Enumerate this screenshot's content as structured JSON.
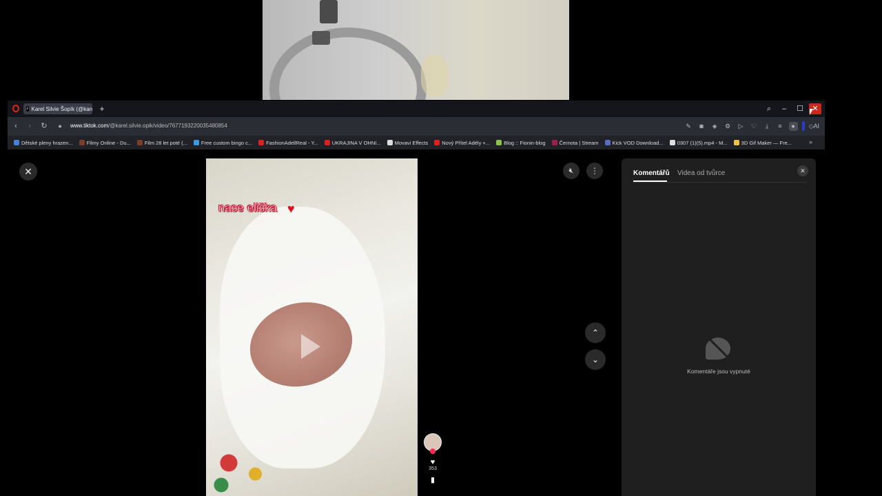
{
  "browser": {
    "tab_title": "Karel Silvie Šopík (@karel...",
    "tab_icon": "tiktok-icon",
    "url_domain": "www.tiktok.com",
    "url_path": "/@karel.silvie.opik/video/7677193220035480854",
    "ai_label": "AI",
    "bookmarks": [
      {
        "label": "Dětské pleny hrazen...",
        "color": "#4a7fd4"
      },
      {
        "label": "Filmy Online - Du...",
        "color": "#7a3e2b"
      },
      {
        "label": "Film 28 let poté (...",
        "color": "#7a3e2b"
      },
      {
        "label": "Free custom bingo c...",
        "color": "#3b9be0"
      },
      {
        "label": "FashionAdellReal - Y...",
        "color": "#e02020"
      },
      {
        "label": "UKRAJINA V OHNI...",
        "color": "#e02020"
      },
      {
        "label": "Movavi Effects",
        "color": "#dddddd"
      },
      {
        "label": "Nový Přítel Adély +...",
        "color": "#e02020"
      },
      {
        "label": "Blog :: Fionin-blog",
        "color": "#8bc34a"
      },
      {
        "label": "Černota | Stream",
        "color": "#9c1f4a"
      },
      {
        "label": "Kick VOD Download...",
        "color": "#5c6bc0"
      },
      {
        "label": "0307 (1)(5).mp4 - M...",
        "color": "#dddddd"
      },
      {
        "label": "3D Gif Maker — Fre...",
        "color": "#f0c040"
      }
    ]
  },
  "video": {
    "caption": "nase eliška",
    "likes": "353"
  },
  "panel": {
    "tab_comments": "Komentářů",
    "tab_creator_videos": "Videa od tvůrce",
    "comments_off": "Komentáře jsou vypnuté"
  }
}
